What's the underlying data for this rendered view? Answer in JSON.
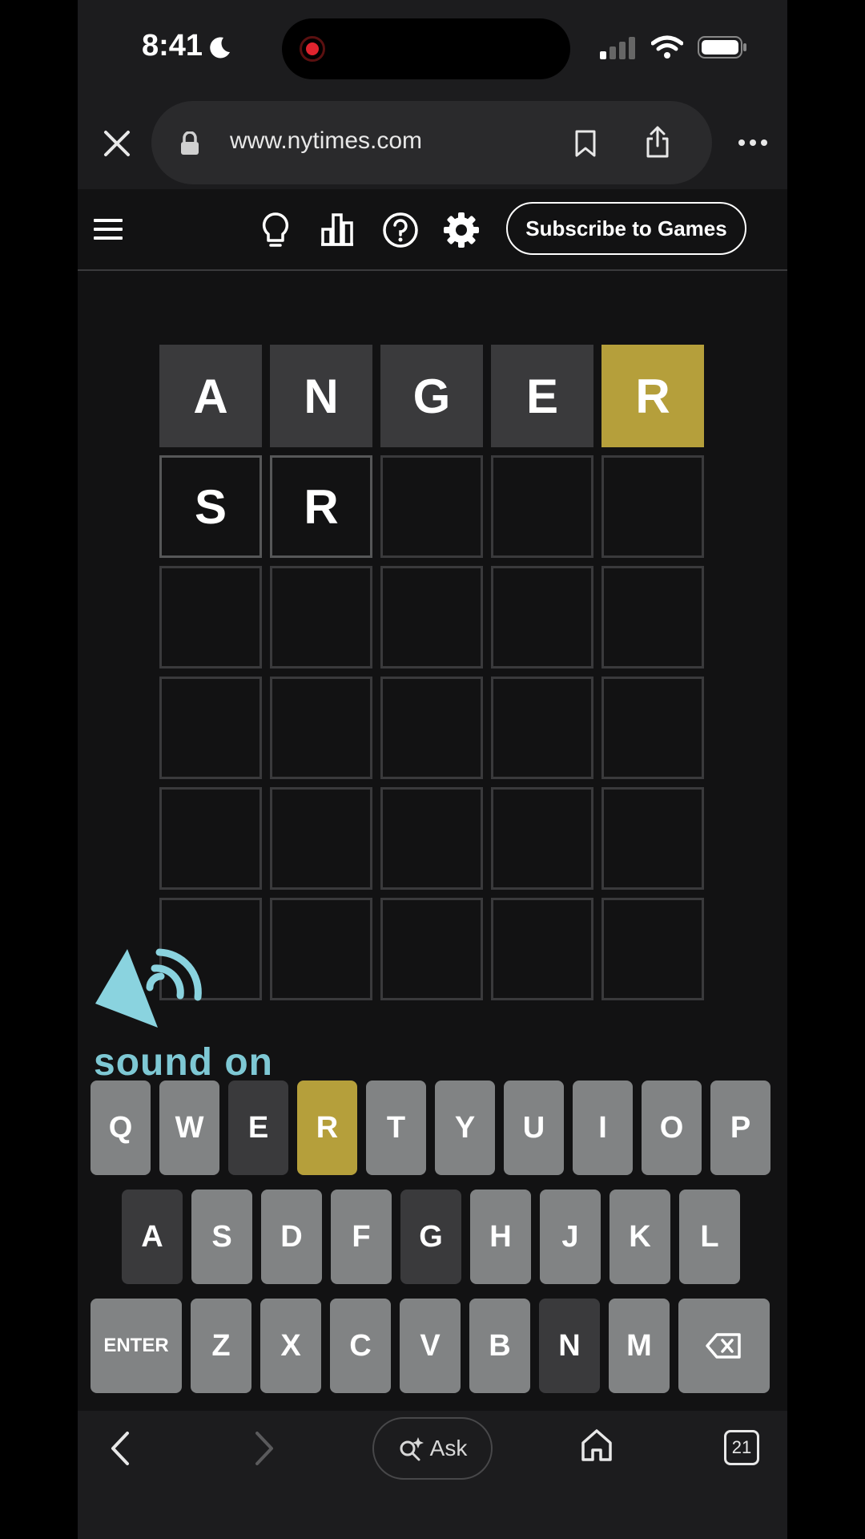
{
  "status_bar": {
    "time": "8:41",
    "icons": [
      "moon-icon",
      "screen-recording-icon",
      "cellular-signal-icon",
      "wifi-icon",
      "battery-icon"
    ]
  },
  "browser": {
    "url": "www.nytimes.com",
    "icons": [
      "close-icon",
      "lock-icon",
      "bookmark-icon",
      "share-icon",
      "more-icon"
    ]
  },
  "game_header": {
    "subscribe_label": "Subscribe to Games",
    "icons": [
      "menu-icon",
      "hint-icon",
      "stats-icon",
      "help-icon",
      "settings-icon"
    ]
  },
  "board": {
    "rows": [
      [
        {
          "letter": "A",
          "state": "absent"
        },
        {
          "letter": "N",
          "state": "absent"
        },
        {
          "letter": "G",
          "state": "absent"
        },
        {
          "letter": "E",
          "state": "absent"
        },
        {
          "letter": "R",
          "state": "present"
        }
      ],
      [
        {
          "letter": "S",
          "state": "filled"
        },
        {
          "letter": "R",
          "state": "filled"
        },
        {
          "letter": "",
          "state": "empty"
        },
        {
          "letter": "",
          "state": "empty"
        },
        {
          "letter": "",
          "state": "empty"
        }
      ],
      [
        {
          "letter": "",
          "state": "empty"
        },
        {
          "letter": "",
          "state": "empty"
        },
        {
          "letter": "",
          "state": "empty"
        },
        {
          "letter": "",
          "state": "empty"
        },
        {
          "letter": "",
          "state": "empty"
        }
      ],
      [
        {
          "letter": "",
          "state": "empty"
        },
        {
          "letter": "",
          "state": "empty"
        },
        {
          "letter": "",
          "state": "empty"
        },
        {
          "letter": "",
          "state": "empty"
        },
        {
          "letter": "",
          "state": "empty"
        }
      ],
      [
        {
          "letter": "",
          "state": "empty"
        },
        {
          "letter": "",
          "state": "empty"
        },
        {
          "letter": "",
          "state": "empty"
        },
        {
          "letter": "",
          "state": "empty"
        },
        {
          "letter": "",
          "state": "empty"
        }
      ],
      [
        {
          "letter": "",
          "state": "empty"
        },
        {
          "letter": "",
          "state": "empty"
        },
        {
          "letter": "",
          "state": "empty"
        },
        {
          "letter": "",
          "state": "empty"
        },
        {
          "letter": "",
          "state": "empty"
        }
      ]
    ]
  },
  "sound_overlay": {
    "text": "sound on",
    "icon": "speaker-icon"
  },
  "keyboard": {
    "rows": [
      [
        {
          "label": "Q",
          "state": "unused"
        },
        {
          "label": "W",
          "state": "unused"
        },
        {
          "label": "E",
          "state": "absent"
        },
        {
          "label": "R",
          "state": "present"
        },
        {
          "label": "T",
          "state": "unused"
        },
        {
          "label": "Y",
          "state": "unused"
        },
        {
          "label": "U",
          "state": "unused"
        },
        {
          "label": "I",
          "state": "unused"
        },
        {
          "label": "O",
          "state": "unused"
        },
        {
          "label": "P",
          "state": "unused"
        }
      ],
      [
        {
          "label": "A",
          "state": "absent"
        },
        {
          "label": "S",
          "state": "unused"
        },
        {
          "label": "D",
          "state": "unused"
        },
        {
          "label": "F",
          "state": "unused"
        },
        {
          "label": "G",
          "state": "absent"
        },
        {
          "label": "H",
          "state": "unused"
        },
        {
          "label": "J",
          "state": "unused"
        },
        {
          "label": "K",
          "state": "unused"
        },
        {
          "label": "L",
          "state": "unused"
        }
      ],
      [
        {
          "label": "ENTER",
          "state": "unused",
          "wide": true
        },
        {
          "label": "Z",
          "state": "unused"
        },
        {
          "label": "X",
          "state": "unused"
        },
        {
          "label": "C",
          "state": "unused"
        },
        {
          "label": "V",
          "state": "unused"
        },
        {
          "label": "B",
          "state": "unused"
        },
        {
          "label": "N",
          "state": "absent"
        },
        {
          "label": "M",
          "state": "unused"
        },
        {
          "label": "",
          "state": "unused",
          "wide": true,
          "icon": "backspace-icon"
        }
      ]
    ]
  },
  "bottom_bar": {
    "ask_label": "Ask",
    "tab_count": "21",
    "icons": [
      "back-icon",
      "forward-icon",
      "ask-sparkle-icon",
      "home-icon",
      "tabs-icon"
    ]
  },
  "colors": {
    "absent": "#3a3a3c",
    "present": "#b59f3b",
    "correct": "#538d4e",
    "unused_key": "#818384",
    "background": "#121213",
    "sound_text": "#7ec8d4"
  }
}
